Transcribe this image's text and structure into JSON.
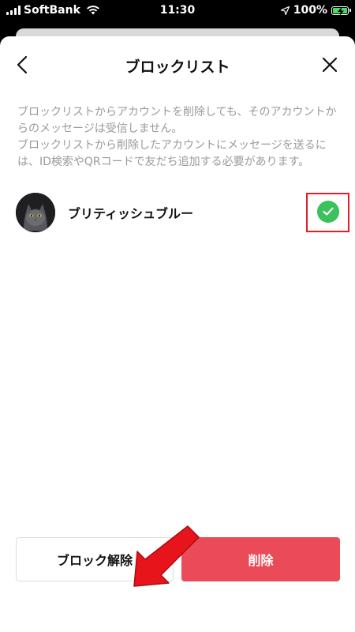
{
  "status_bar": {
    "carrier": "SoftBank",
    "time": "11:30",
    "battery": "100%"
  },
  "header": {
    "title": "ブロックリスト"
  },
  "description": {
    "line1": "ブロックリストからアカウントを削除しても、そのアカウントからのメッセージは受信しません。",
    "line2": "ブロックリストから削除したアカウントにメッセージを送るには、ID検索やQRコードで友だち追加する必要があります。"
  },
  "blocked_users": [
    {
      "name": "ブリティッシュブルー",
      "selected": true
    }
  ],
  "actions": {
    "unblock_label": "ブロック解除",
    "delete_label": "削除"
  },
  "colors": {
    "accent_delete": "#eb4b58",
    "check_green": "#3bc25a",
    "highlight_red": "#e01e26"
  }
}
